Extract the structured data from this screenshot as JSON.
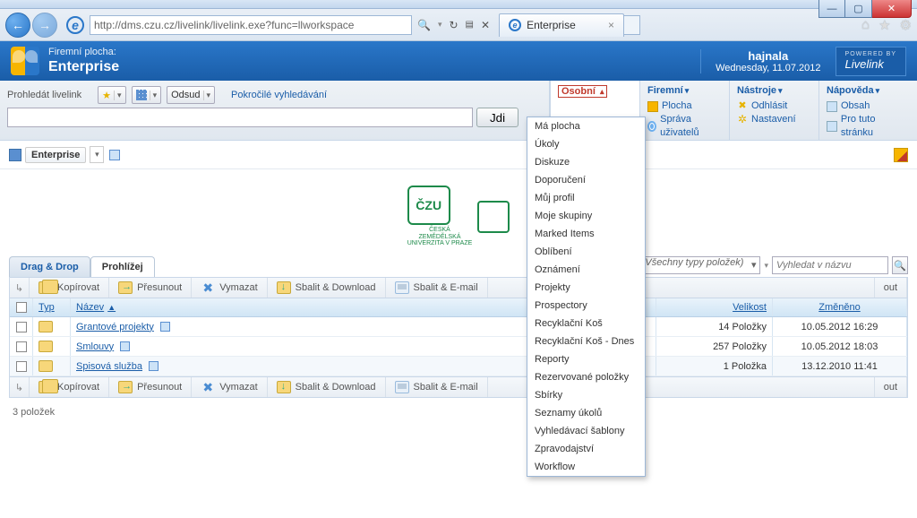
{
  "browser": {
    "url": "http://dms.czu.cz/livelink/livelink.exe?func=llworkspace",
    "tab_title": "Enterprise"
  },
  "header": {
    "supertitle": "Firemní plocha:",
    "title": "Enterprise",
    "username": "hajnala",
    "date": "Wednesday, 11.07.2012",
    "brand_powered": "POWERED BY",
    "brand": "Livelink"
  },
  "search": {
    "label": "Prohledát livelink",
    "scope": "Odsud",
    "advanced": "Pokročilé vyhledávání",
    "go": "Jdi"
  },
  "menubar": {
    "tabs": {
      "osobni": "Osobní",
      "firemni": "Firemní",
      "nastroje": "Nástroje",
      "napoveda": "Nápověda"
    },
    "firemni_links": {
      "plocha": "Plocha",
      "sprava": "Správa uživatelů"
    },
    "nastroje_links": {
      "odhlasit": "Odhlásit",
      "nastaveni": "Nastavení"
    },
    "napoveda_links": {
      "obsah": "Obsah",
      "protuto": "Pro tuto stránku"
    }
  },
  "osobni_menu": [
    "Má plocha",
    "Úkoly",
    "Diskuze",
    "Doporučení",
    "Můj profil",
    "Moje skupiny",
    "Marked Items",
    "Oblíbení",
    "Oznámení",
    "Projekty",
    "Prospectory",
    "Recyklační Koš",
    "Recyklační Koš - Dnes",
    "Reporty",
    "Rezervované položky",
    "Sbírky",
    "Seznamy úkolů",
    "Vyhledávací šablony",
    "Zpravodajství",
    "Workflow"
  ],
  "breadcrumb": {
    "name": "Enterprise"
  },
  "viewtabs": {
    "drag": "Drag & Drop",
    "browse": "Prohlížej"
  },
  "filter": {
    "types": "(Všechny typy položek)",
    "nameplaceholder": "Vyhledat v názvu"
  },
  "toolbar": {
    "kopirovat": "Kopírovat",
    "presunout": "Přesunout",
    "vymazat": "Vymazat",
    "sbalit": "Sbalit & Download",
    "sbalitmail": "Sbalit & E-mail",
    "out_suffix": "out"
  },
  "columns": {
    "typ": "Typ",
    "nazev": "Název",
    "velikost": "Velikost",
    "zmeneno": "Změněno"
  },
  "rows": [
    {
      "name": "Grantové projekty",
      "size": "14 Položky",
      "date": "10.05.2012 16:29"
    },
    {
      "name": "Smlouvy",
      "size": "257 Položky",
      "date": "10.05.2012 18:03"
    },
    {
      "name": "Spisová služba",
      "size": "1 Položka",
      "date": "13.12.2010 11:41"
    }
  ],
  "footer": {
    "count": "3 položek"
  },
  "czu": {
    "code": "ČZU",
    "sub": "ČESKÁ\nZEMĚDĚLSKÁ\nUNIVERZITA V PRAZE"
  }
}
